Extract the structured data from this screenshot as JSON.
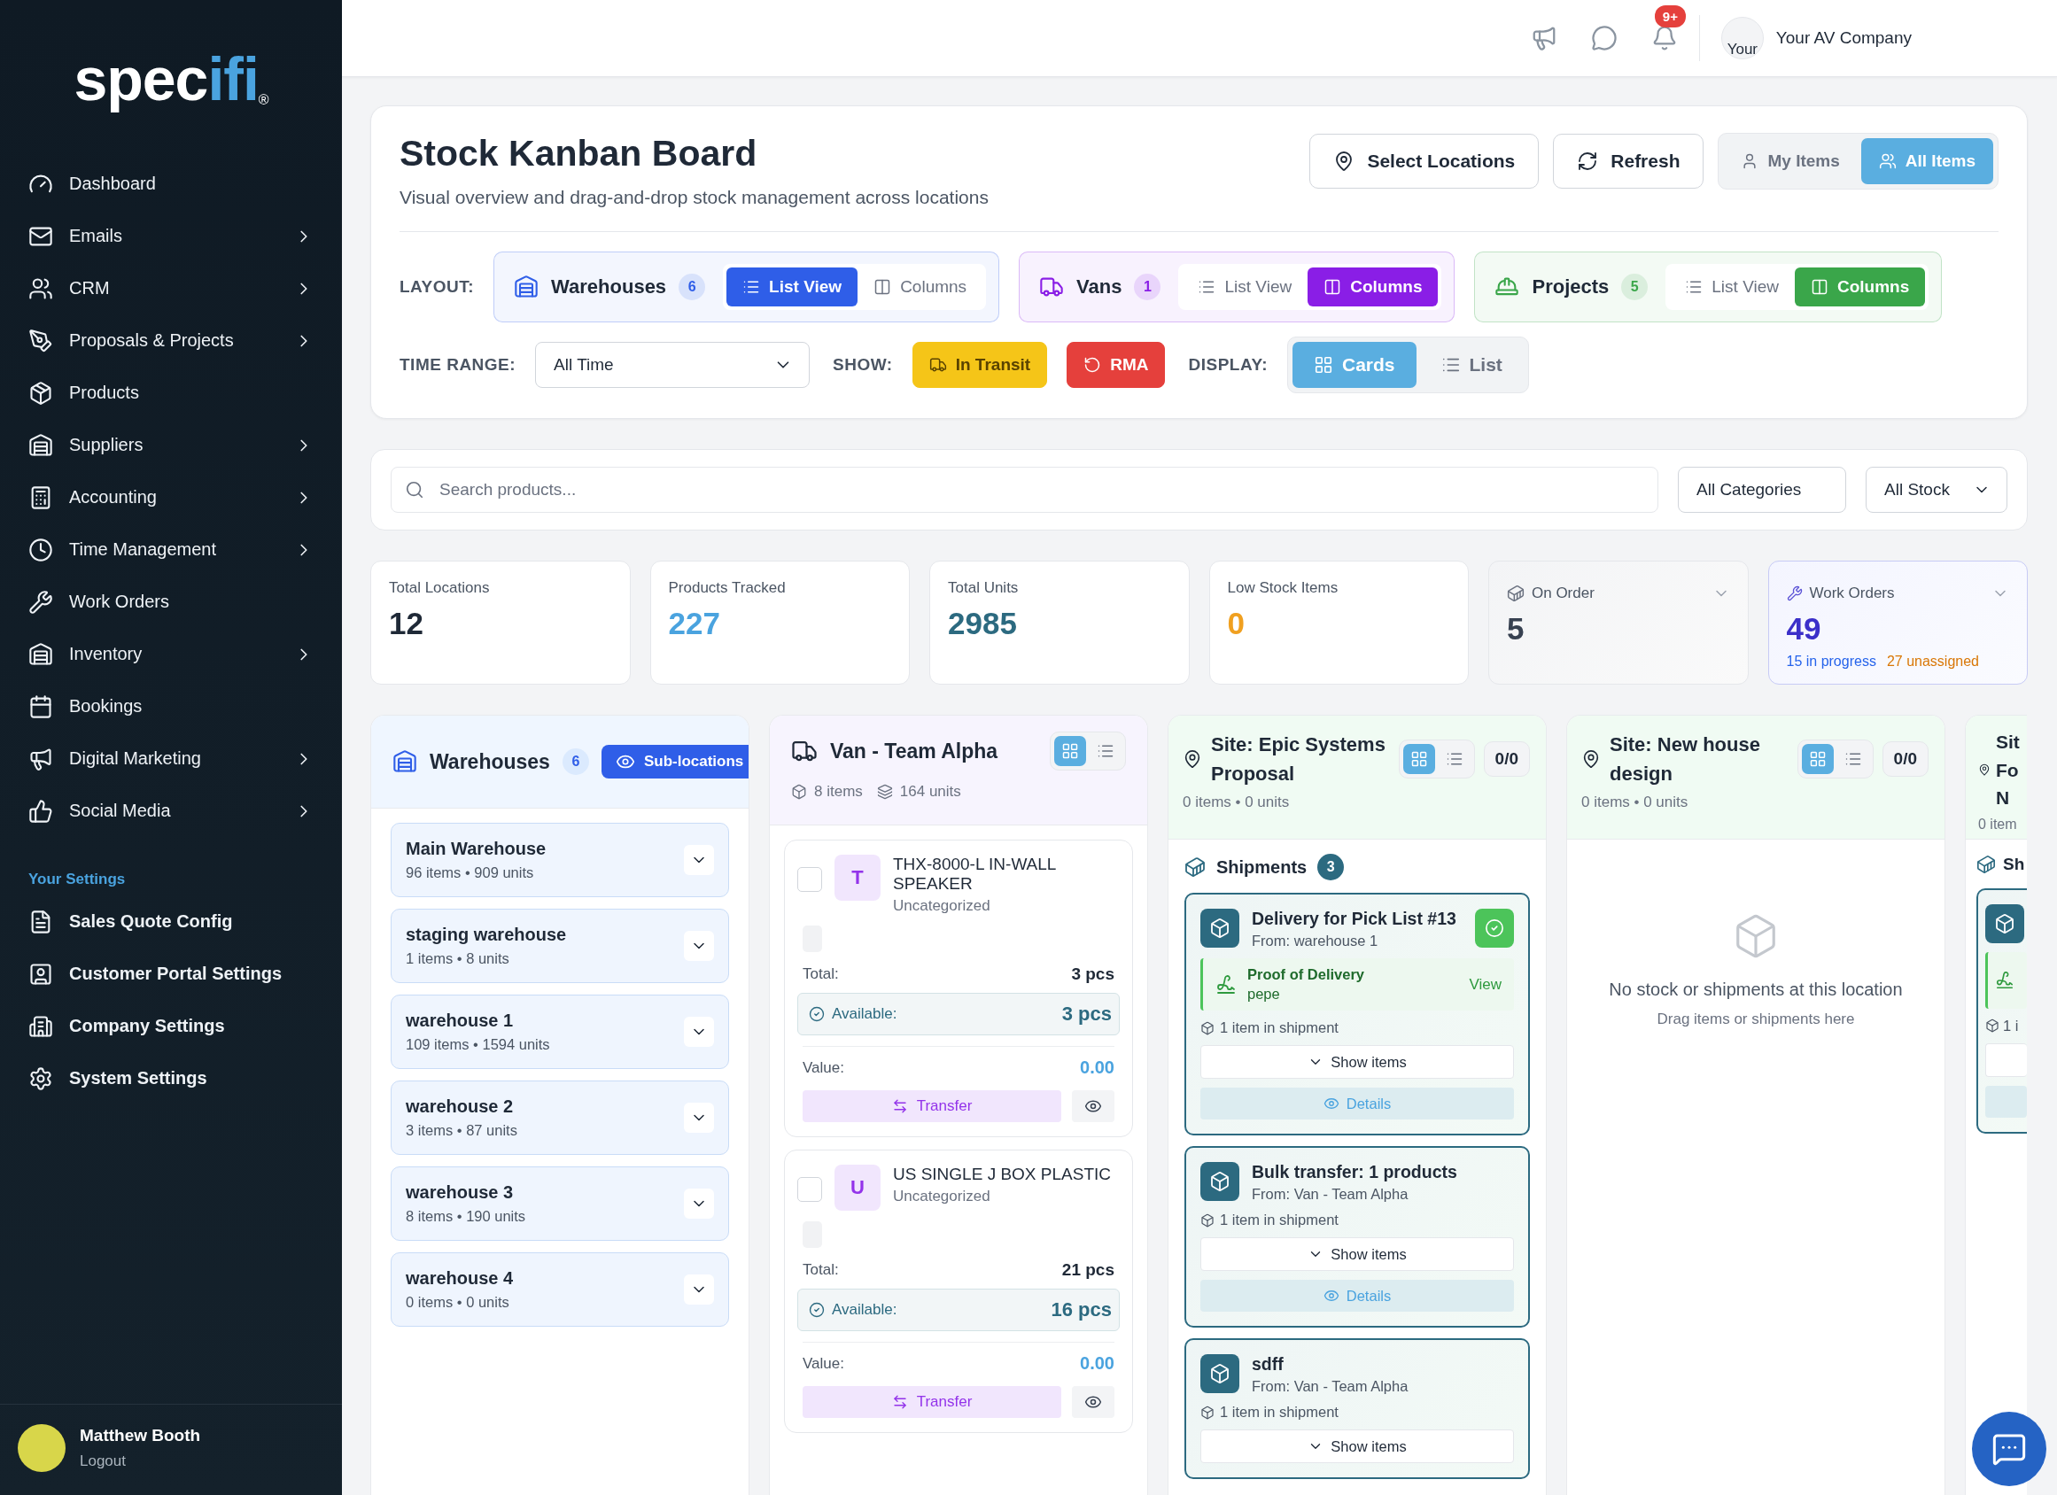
{
  "sidebar": {
    "logo": [
      {
        "text": "spec",
        "color": "#ffffff"
      },
      {
        "text": "ifi",
        "color": "#4aa3df"
      }
    ],
    "logo_mark": "®",
    "items": [
      {
        "label": "Dashboard",
        "has_submenu": false
      },
      {
        "label": "Emails",
        "has_submenu": true
      },
      {
        "label": "CRM",
        "has_submenu": true
      },
      {
        "label": "Proposals & Projects",
        "has_submenu": true
      },
      {
        "label": "Products",
        "has_submenu": false
      },
      {
        "label": "Suppliers",
        "has_submenu": true
      },
      {
        "label": "Accounting",
        "has_submenu": true
      },
      {
        "label": "Time Management",
        "has_submenu": true
      },
      {
        "label": "Work Orders",
        "has_submenu": false
      },
      {
        "label": "Inventory",
        "has_submenu": true
      },
      {
        "label": "Bookings",
        "has_submenu": false
      },
      {
        "label": "Digital Marketing",
        "has_submenu": true
      },
      {
        "label": "Social Media",
        "has_submenu": true
      }
    ],
    "settings_title": "Your Settings",
    "settings_items": [
      {
        "label": "Sales Quote Config"
      },
      {
        "label": "Customer Portal Settings"
      },
      {
        "label": "Company Settings"
      },
      {
        "label": "System Settings"
      }
    ],
    "user": {
      "name": "Matthew Booth",
      "action": "Logout"
    }
  },
  "header": {
    "notification_badge": "9+",
    "avatar_text": "Your",
    "company": "Your AV Company"
  },
  "page": {
    "title": "Stock Kanban Board",
    "subtitle": "Visual overview and drag-and-drop stock management across locations",
    "buttons": [
      "Select Locations",
      "Refresh"
    ],
    "scope_tabs": [
      {
        "label": "My Items",
        "selected": false
      },
      {
        "label": "All Items",
        "selected": true
      }
    ]
  },
  "layout": {
    "label": "LAYOUT:",
    "groups": [
      {
        "name": "Warehouses",
        "count": "6",
        "color": "#2f5ee8",
        "views": [
          {
            "label": "List View",
            "selected": true
          },
          {
            "label": "Columns",
            "selected": false
          }
        ]
      },
      {
        "name": "Vans",
        "count": "1",
        "color": "#8a1ee6",
        "views": [
          {
            "label": "List View",
            "selected": false
          },
          {
            "label": "Columns",
            "selected": true
          }
        ]
      },
      {
        "name": "Projects",
        "count": "5",
        "color": "#3aa64a",
        "views": [
          {
            "label": "List View",
            "selected": false
          },
          {
            "label": "Columns",
            "selected": true
          }
        ]
      }
    ]
  },
  "filters": {
    "time_range_label": "TIME RANGE:",
    "time_range": "All Time",
    "show_label": "SHOW:",
    "show_toggles": [
      {
        "label": "In Transit",
        "on": true,
        "color": "#f5c518"
      },
      {
        "label": "RMA",
        "on": true,
        "color": "#e5403c"
      }
    ],
    "display_label": "DISPLAY:",
    "display_options": [
      {
        "label": "Cards",
        "selected": true
      },
      {
        "label": "List",
        "selected": false
      }
    ]
  },
  "search": {
    "placeholder": "Search products...",
    "category": "All Categories",
    "stock": "All Stock"
  },
  "stats": [
    {
      "label": "Total Locations",
      "value": "12",
      "color": "#1f2937",
      "kind": "plain"
    },
    {
      "label": "Products Tracked",
      "value": "227",
      "color": "#4aa3df",
      "kind": "plain"
    },
    {
      "label": "Total Units",
      "value": "2985",
      "color": "#2c6a80",
      "kind": "plain"
    },
    {
      "label": "Low Stock Items",
      "value": "0",
      "color": "#f0a020",
      "kind": "plain"
    },
    {
      "label": "On Order",
      "value": "5",
      "color": "#374151",
      "kind": "expandable"
    },
    {
      "label": "Work Orders",
      "value": "49",
      "color": "#3b2fc9",
      "kind": "accent",
      "notes": [
        {
          "text": "15 in progress",
          "color": "#2563eb"
        },
        {
          "text": "27 unassigned",
          "color": "#d97706"
        }
      ]
    }
  ],
  "columns": [
    {
      "kind": "warehouses",
      "title": "Warehouses",
      "count": "6",
      "action": "Sub-locations",
      "locations": [
        {
          "name": "Main Warehouse",
          "meta": "96 items • 909 units"
        },
        {
          "name": "staging warehouse",
          "meta": "1 items • 8 units"
        },
        {
          "name": "warehouse 1",
          "meta": "109 items • 1594 units"
        },
        {
          "name": "warehouse 2",
          "meta": "3 items • 87 units"
        },
        {
          "name": "warehouse 3",
          "meta": "8 items • 190 units"
        },
        {
          "name": "warehouse 4",
          "meta": "0 items • 0 units"
        }
      ]
    },
    {
      "kind": "van",
      "title": "Van - Team Alpha",
      "items": "8 items",
      "units": "164 units",
      "views": [
        {
          "selected": true
        },
        {
          "selected": false
        }
      ],
      "products": [
        {
          "initial": "T",
          "name": "THX-8000-L IN-WALL SPEAKER",
          "category": "Uncategorized",
          "checked": false,
          "total_label": "Total:",
          "total": "3 pcs",
          "available_label": "Available:",
          "available": "3 pcs",
          "value_label": "Value:",
          "value": "0.00",
          "action": "Transfer"
        },
        {
          "initial": "U",
          "name": "US SINGLE J BOX PLASTIC",
          "category": "Uncategorized",
          "checked": false,
          "total_label": "Total:",
          "total": "21 pcs",
          "available_label": "Available:",
          "available": "16 pcs",
          "value_label": "Value:",
          "value": "0.00",
          "action": "Transfer"
        }
      ]
    },
    {
      "kind": "site",
      "title": "Site: Epic Systems Proposal",
      "ratio": "0/0",
      "meta": "0 items • 0 units",
      "views": [
        {
          "selected": true
        },
        {
          "selected": false
        }
      ],
      "shipments_title": "Shipments",
      "shipments_count": "3",
      "shipments": [
        {
          "title": "Delivery for Pick List #13",
          "from": "From: warehouse 1",
          "delivered": true,
          "proof": {
            "label": "Proof of Delivery",
            "name": "pepe",
            "action": "View"
          },
          "summary": "1 item in shipment",
          "show": "Show items",
          "details": "Details"
        },
        {
          "title": "Bulk transfer: 1 products",
          "from": "From: Van - Team Alpha",
          "delivered": false,
          "summary": "1 item in shipment",
          "show": "Show items",
          "details": "Details"
        },
        {
          "title": "sdff",
          "from": "From: Van - Team Alpha",
          "delivered": false,
          "summary": "1 item in shipment",
          "show": "Show items"
        }
      ]
    },
    {
      "kind": "site",
      "title": "Site: New house design",
      "ratio": "0/0",
      "meta": "0 items • 0 units",
      "views": [
        {
          "selected": true
        },
        {
          "selected": false
        }
      ],
      "empty": {
        "title": "No stock or shipments at this location",
        "hint": "Drag items or shipments here"
      }
    },
    {
      "kind": "partial",
      "title_lines": [
        "Sit",
        "Fo",
        "N"
      ],
      "meta": "0 item",
      "shipments_title": "Sh",
      "summary": "1 i"
    }
  ]
}
